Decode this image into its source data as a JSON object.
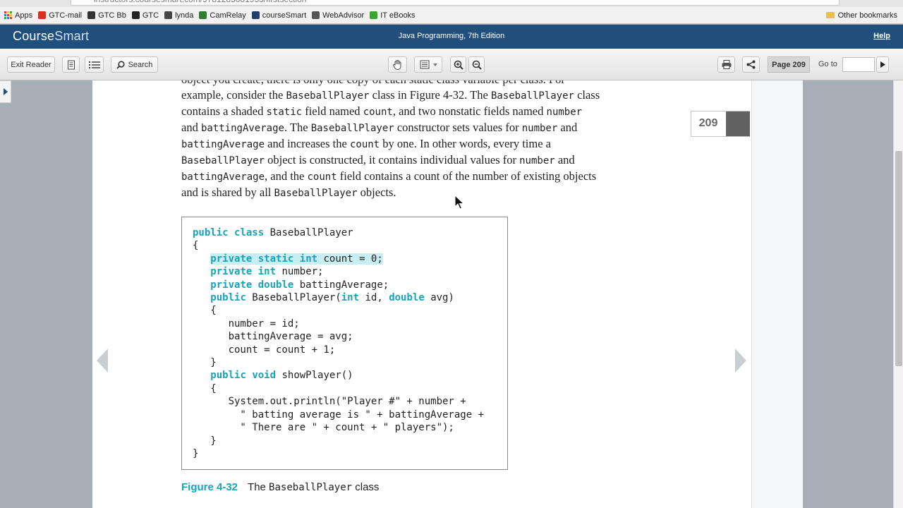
{
  "browser": {
    "url": "instructors.coursesmart.com/9781285081953/firstsection",
    "bookmarks": [
      {
        "label": "Apps",
        "color": "#d44"
      },
      {
        "label": "GTC-mail",
        "color": "#d93025"
      },
      {
        "label": "GTC Bb",
        "color": "#333"
      },
      {
        "label": "GTC",
        "color": "#222"
      },
      {
        "label": "lynda",
        "color": "#444"
      },
      {
        "label": "CamRelay",
        "color": "#2e7d32"
      },
      {
        "label": "courseSmart",
        "color": "#1f3f6a"
      },
      {
        "label": "WebAdvisor",
        "color": "#555"
      },
      {
        "label": "IT eBooks",
        "color": "#3aa52f"
      }
    ],
    "other_bookmarks": "Other bookmarks"
  },
  "header": {
    "logo_main": "Course",
    "logo_light": "Smart",
    "title": "Java Programming, 7th Edition",
    "help": "Help"
  },
  "toolbar": {
    "exit_reader": "Exit Reader",
    "search": "Search",
    "page_indicator": "Page 209",
    "goto_label": "Go to",
    "goto_value": ""
  },
  "page": {
    "number": "209",
    "cut_line": "object you create, there is only one copy of each static class variable per class. For",
    "paragraph_lines": [
      [
        "example, consider the ",
        "BaseballPlayer",
        " class in Figure 4-32. The ",
        "BaseballPlayer",
        " class"
      ],
      [
        "contains a shaded ",
        "static",
        " field named ",
        "count",
        ", and two nonstatic fields named ",
        "number"
      ],
      [
        "and ",
        "battingAverage",
        ". The ",
        "BaseballPlayer",
        " constructor sets values for ",
        "number",
        " and"
      ],
      [
        "",
        "battingAverage",
        " and increases the ",
        "count",
        " by one. In other words, every time a"
      ],
      [
        "",
        "BaseballPlayer",
        " object is constructed, it contains individual values for ",
        "number",
        " and"
      ],
      [
        "",
        "battingAverage",
        ", and the ",
        "count",
        " field contains a count of the number of existing objects"
      ],
      [
        "and is shared by all ",
        "BaseballPlayer",
        " objects."
      ]
    ],
    "code_lines": [
      "public class BaseballPlayer",
      "{",
      "   private static int count = 0;",
      "   private int number;",
      "   private double battingAverage;",
      "   public BaseballPlayer(int id, double avg)",
      "   {",
      "      number = id;",
      "      battingAverage = avg;",
      "      count = count + 1;",
      "   }",
      "   public void showPlayer()",
      "   {",
      "      System.out.println(\"Player #\" + number +",
      "        \" batting average is \" + battingAverage +",
      "        \" There are \" + count + \" players\");",
      "   }",
      "}"
    ],
    "caption_label": "Figure 4-32",
    "caption_pre": "The ",
    "caption_code": "BaseballPlayer",
    "caption_post": " class"
  },
  "colors": {
    "header_bg": "#1f4f7a",
    "keyword": "#17a3b8",
    "highlight": "#c9eef2"
  }
}
